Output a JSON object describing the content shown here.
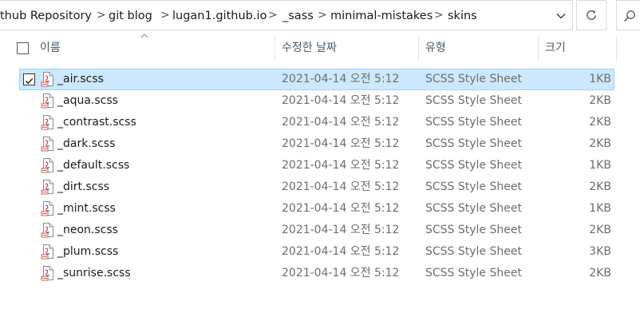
{
  "address_bar": {
    "crumbs": [
      "thub Repository",
      "git blog",
      "lugan1.github.io",
      "_sass",
      "minimal-mistakes",
      "skins"
    ],
    "separator": ">"
  },
  "columns": {
    "name": "이름",
    "date": "수정한 날짜",
    "type": "유형",
    "size": "크기"
  },
  "files": [
    {
      "name": "_air.scss",
      "date": "2021-04-14 오전 5:12",
      "type": "SCSS Style Sheet",
      "size": "1KB",
      "selected": true
    },
    {
      "name": "_aqua.scss",
      "date": "2021-04-14 오전 5:12",
      "type": "SCSS Style Sheet",
      "size": "2KB"
    },
    {
      "name": "_contrast.scss",
      "date": "2021-04-14 오전 5:12",
      "type": "SCSS Style Sheet",
      "size": "2KB"
    },
    {
      "name": "_dark.scss",
      "date": "2021-04-14 오전 5:12",
      "type": "SCSS Style Sheet",
      "size": "2KB"
    },
    {
      "name": "_default.scss",
      "date": "2021-04-14 오전 5:12",
      "type": "SCSS Style Sheet",
      "size": "1KB"
    },
    {
      "name": "_dirt.scss",
      "date": "2021-04-14 오전 5:12",
      "type": "SCSS Style Sheet",
      "size": "2KB"
    },
    {
      "name": "_mint.scss",
      "date": "2021-04-14 오전 5:12",
      "type": "SCSS Style Sheet",
      "size": "1KB"
    },
    {
      "name": "_neon.scss",
      "date": "2021-04-14 오전 5:12",
      "type": "SCSS Style Sheet",
      "size": "2KB"
    },
    {
      "name": "_plum.scss",
      "date": "2021-04-14 오전 5:12",
      "type": "SCSS Style Sheet",
      "size": "3KB"
    },
    {
      "name": "_sunrise.scss",
      "date": "2021-04-14 오전 5:12",
      "type": "SCSS Style Sheet",
      "size": "2KB"
    }
  ],
  "colors": {
    "selection_bg": "#cce8ff",
    "selection_border": "#99d1ff",
    "header_text": "#4a5a6a",
    "detail_text": "#6d6d6d"
  },
  "icons": {
    "file": "scss-file-icon",
    "refresh": "refresh-icon",
    "search": "search-icon",
    "dropdown": "chevron-down-icon",
    "sort": "sort-up-icon"
  }
}
